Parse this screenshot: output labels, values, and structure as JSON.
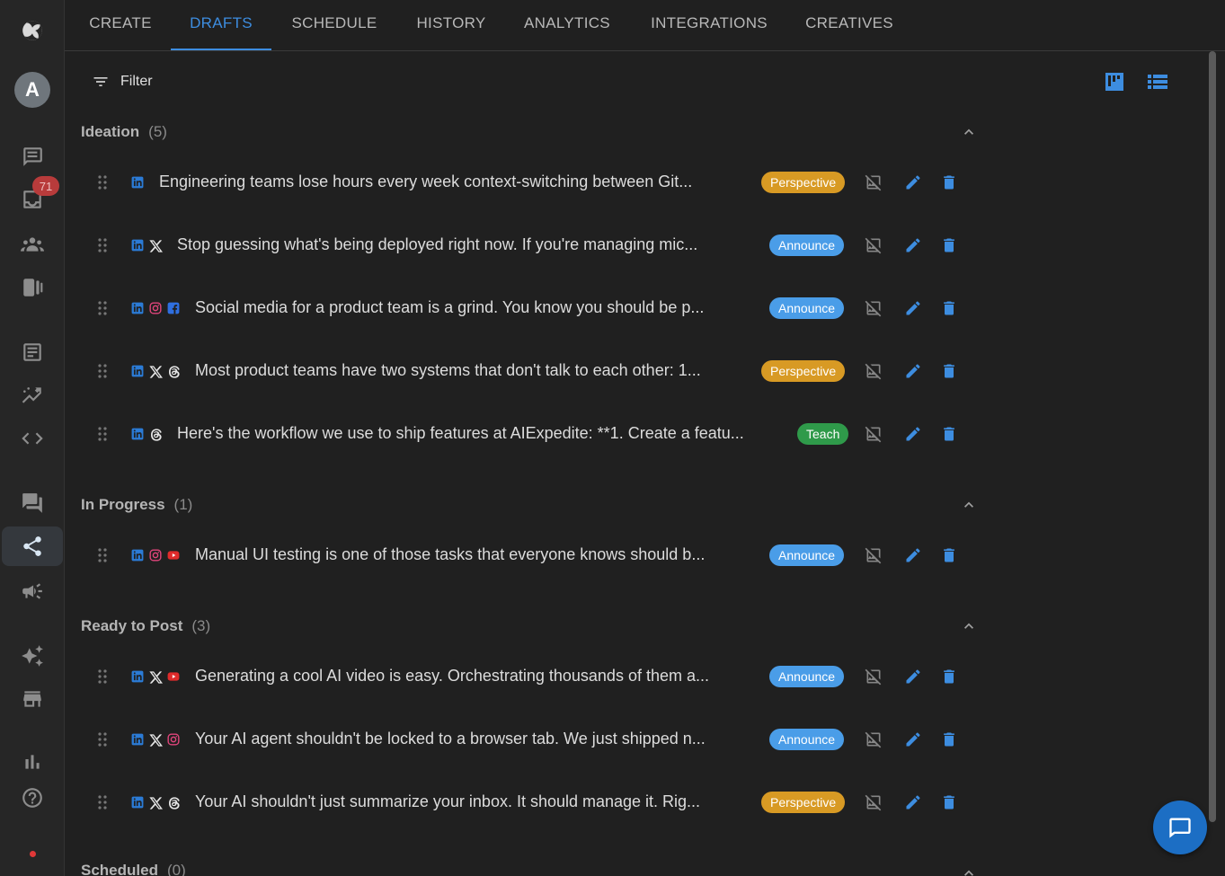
{
  "rail": {
    "avatar_letter": "A",
    "inbox_badge": "71"
  },
  "tabs": [
    {
      "label": "CREATE"
    },
    {
      "label": "DRAFTS"
    },
    {
      "label": "SCHEDULE"
    },
    {
      "label": "HISTORY"
    },
    {
      "label": "ANALYTICS"
    },
    {
      "label": "INTEGRATIONS"
    },
    {
      "label": "CREATIVES"
    }
  ],
  "toolbar": {
    "filter_label": "Filter"
  },
  "sections": [
    {
      "title": "Ideation",
      "count": "(5)",
      "rows": [
        {
          "text": "Engineering teams lose hours every week context-switching between Git...",
          "tag": "Perspective"
        },
        {
          "text": "Stop guessing what's being deployed right now. If you're managing mic...",
          "tag": "Announce"
        },
        {
          "text": "Social media for a product team is a grind. You know you should be p...",
          "tag": "Announce"
        },
        {
          "text": "Most product teams have two systems that don't talk to each other: 1...",
          "tag": "Perspective"
        },
        {
          "text": "Here's the workflow we use to ship features at AIExpedite: **1. Create a featu...",
          "tag": "Teach"
        }
      ]
    },
    {
      "title": "In Progress",
      "count": "(1)",
      "rows": [
        {
          "text": "Manual UI testing is one of those tasks that everyone knows should b...",
          "tag": "Announce"
        }
      ]
    },
    {
      "title": "Ready to Post",
      "count": "(3)",
      "rows": [
        {
          "text": "Generating a cool AI video is easy. Orchestrating thousands of them a...",
          "tag": "Announce"
        },
        {
          "text": "Your AI agent shouldn't be locked to a browser tab. We just shipped n...",
          "tag": "Announce"
        },
        {
          "text": "Your AI shouldn't just summarize your inbox. It should manage it. Rig...",
          "tag": "Perspective"
        }
      ]
    },
    {
      "title": "Scheduled",
      "count": "(0)",
      "rows": []
    }
  ],
  "colors": {
    "accent": "#3d8de0",
    "perspective": "#d89a24",
    "announce": "#4a9de8",
    "teach": "#2f9a4a",
    "background": "#202020"
  }
}
